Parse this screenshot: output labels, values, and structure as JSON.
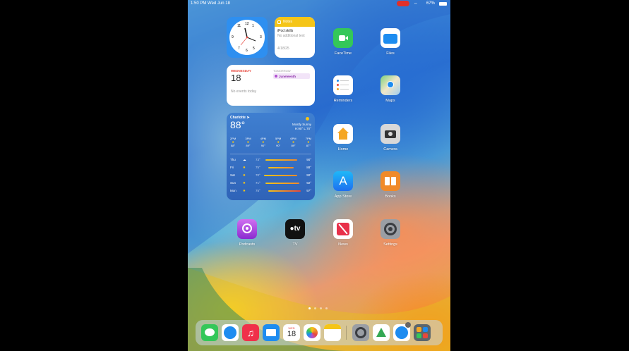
{
  "status_bar": {
    "time": "1:50 PM  Wed Jun 18",
    "battery": "67%"
  },
  "clock_widget": {
    "numbers": [
      "12",
      "1",
      "2",
      "3",
      "4",
      "5",
      "6",
      "7",
      "8",
      "9",
      "10",
      "11"
    ]
  },
  "notes_widget": {
    "app": "Notes",
    "title": "iPod skills",
    "subtitle": "No additional text",
    "date": "4/18/25"
  },
  "calendar_widget": {
    "day_name": "WEDNESDAY",
    "day_number": "18",
    "no_events": "No events today",
    "tomorrow_label": "TOMORROW",
    "event": "Juneteenth"
  },
  "weather_widget": {
    "city": "Charlotte",
    "temp": "88°",
    "condition": "Mostly Sunny",
    "hi_lo": "H:90° L:70°",
    "hourly": [
      {
        "time": "2PM",
        "temp": "88°"
      },
      {
        "time": "3PM",
        "temp": "89°"
      },
      {
        "time": "4PM",
        "temp": "90°"
      },
      {
        "time": "5PM",
        "temp": "90°"
      },
      {
        "time": "6PM",
        "temp": "89°"
      },
      {
        "time": "7PM",
        "temp": "87°"
      }
    ],
    "daily": [
      {
        "day": "Thu",
        "low": "73°",
        "high": "90°",
        "icon": "rain"
      },
      {
        "day": "Fri",
        "low": "75°",
        "high": "88°",
        "icon": "sun"
      },
      {
        "day": "Sat",
        "low": "70°",
        "high": "90°",
        "icon": "sun"
      },
      {
        "day": "Sun",
        "low": "71°",
        "high": "92°",
        "icon": "sun"
      },
      {
        "day": "Mon",
        "low": "75°",
        "high": "97°",
        "icon": "sun"
      }
    ]
  },
  "apps": {
    "facetime": "FaceTime",
    "files": "Files",
    "reminders": "Reminders",
    "maps": "Maps",
    "home": "Home",
    "camera": "Camera",
    "appstore": "App Store",
    "books": "Books",
    "podcasts": "Podcasts",
    "tv": "TV",
    "news": "News",
    "settings": "Settings"
  },
  "dock": {
    "calendar_day": "WED",
    "calendar_num": "18"
  },
  "colors": {
    "accent": "#f5c518",
    "calendar_red": "#e8473c"
  }
}
